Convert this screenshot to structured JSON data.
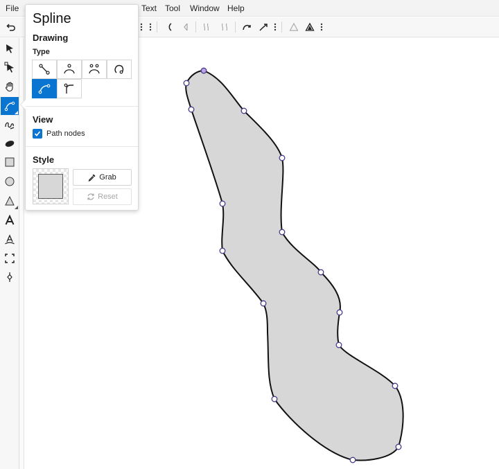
{
  "menubar": {
    "file": "File",
    "text": "Text",
    "tool": "Tool",
    "window": "Window",
    "help": "Help"
  },
  "panel": {
    "title": "Spline",
    "drawing_heading": "Drawing",
    "type_label": "Type",
    "type_buttons": [
      {
        "icon": "line-segment-icon",
        "active": false
      },
      {
        "icon": "arc-up-icon",
        "active": false
      },
      {
        "icon": "arc-double-icon",
        "active": false
      },
      {
        "icon": "loop-icon",
        "active": false
      },
      {
        "icon": "spline-curve-icon",
        "active": true
      },
      {
        "icon": "corner-curve-icon",
        "active": false
      }
    ],
    "view_heading": "View",
    "path_nodes_label": "Path nodes",
    "path_nodes_checked": true,
    "style_heading": "Style",
    "fill_color": "#d7d7d7",
    "grab_label": "Grab",
    "reset_label": "Reset"
  },
  "colors": {
    "accent": "#0a74d1",
    "shape_fill": "#d7d7d7",
    "node_stroke": "#4a3a8a",
    "selected_node": "#b9a3e3"
  }
}
